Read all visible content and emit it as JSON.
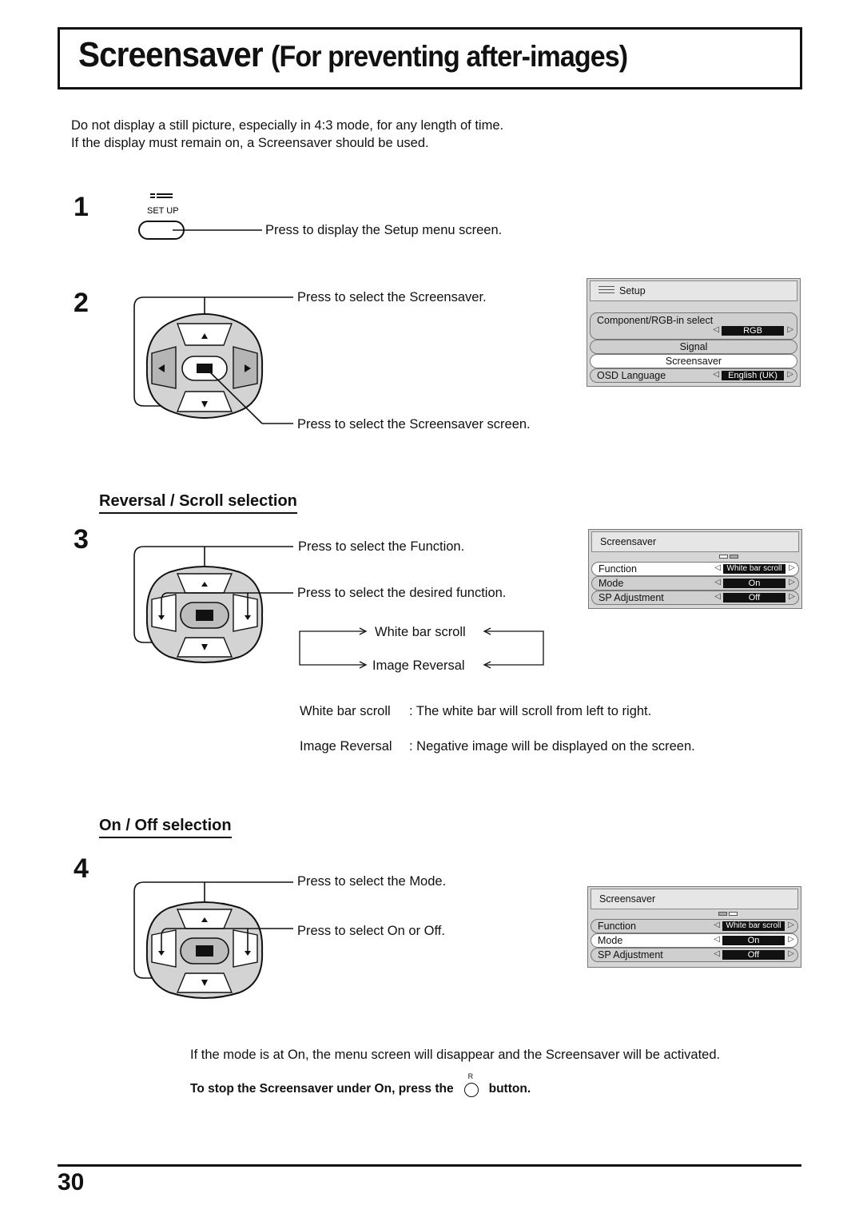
{
  "title": {
    "main": "Screensaver",
    "sub": "(For preventing after-images)"
  },
  "intro": [
    "Do not display a still picture, especially in 4:3 mode, for any length of time.",
    "If the display must remain on, a Screensaver should be used."
  ],
  "step1": {
    "number": "1",
    "button_label": "SET UP",
    "button_icon": "menu-lines-icon",
    "instruction": "Press to display the Setup menu screen."
  },
  "step2": {
    "number": "2",
    "instruction_updown": "Press to select the Screensaver.",
    "instruction_action": "Press to select the Screensaver screen.",
    "menu": {
      "title": "Setup",
      "rows": [
        {
          "label": "Component/RGB-in select",
          "value": "RGB"
        },
        {
          "label": "Signal"
        },
        {
          "label": "Screensaver",
          "highlighted": true
        },
        {
          "label": "OSD  Language",
          "value": "English (UK)"
        }
      ]
    }
  },
  "section_reversal": {
    "heading": "Reversal / Scroll selection"
  },
  "step3": {
    "number": "3",
    "instruction_updown": "Press to select the Function.",
    "instruction_leftright": "Press to select the desired function.",
    "cycle": [
      "White bar scroll",
      "Image Reversal"
    ],
    "definitions": [
      {
        "term": "White bar scroll",
        "desc": ": The white bar will scroll from left to right."
      },
      {
        "term": "Image Reversal",
        "desc": ": Negative image will be displayed on the screen."
      }
    ],
    "menu": {
      "title": "Screensaver",
      "page_indicator": "1 of 2",
      "rows": [
        {
          "label": "Function",
          "value": "White bar scroll",
          "highlighted": true
        },
        {
          "label": "Mode",
          "value": "On"
        },
        {
          "label": "SP Adjustment",
          "value": "Off"
        }
      ]
    }
  },
  "section_onoff": {
    "heading": "On / Off selection"
  },
  "step4": {
    "number": "4",
    "instruction_updown": "Press to select the Mode.",
    "instruction_leftright": "Press to select On or Off.",
    "menu": {
      "title": "Screensaver",
      "page_indicator": "2 of 2",
      "rows": [
        {
          "label": "Function",
          "value": "White bar scroll"
        },
        {
          "label": "Mode",
          "value": "On",
          "highlighted": true
        },
        {
          "label": "SP Adjustment",
          "value": "Off"
        }
      ]
    }
  },
  "footer_note": {
    "text": "If the mode is at On, the menu screen will disappear and the Screensaver will be activated.",
    "stop_prefix": "To stop the Screensaver under On, press the",
    "stop_button_label": "R",
    "stop_suffix": "button."
  },
  "page_number": "30"
}
